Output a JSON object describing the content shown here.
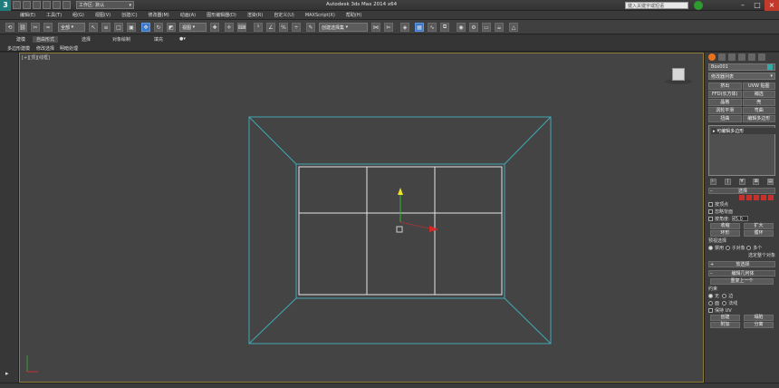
{
  "titlebar": {
    "logo": "3",
    "workspace": "工作区: 默认",
    "app_title": "Autodesk 3ds Max 2014 x64",
    "search_placeholder": "键入关键字或短语"
  },
  "menu": [
    "编辑(E)",
    "工具(T)",
    "组(G)",
    "视图(V)",
    "创建(C)",
    "修改器(M)",
    "动画(A)",
    "图形编辑器(D)",
    "渲染(R)",
    "自定义(U)",
    "MAXScript(X)",
    "帮助(H)"
  ],
  "toolbar": {
    "filter": "全部",
    "view": "视图",
    "named_sel": "创建选择集"
  },
  "ribbon": {
    "tabs": [
      "建模",
      "自由形式",
      "选择",
      "对象绘制",
      "填充"
    ],
    "subtabs": [
      "多边形建模",
      "修改选择",
      "明暗处理"
    ]
  },
  "viewport": {
    "label": "[+][顶][线框]"
  },
  "command_panel": {
    "object_name": "Box001",
    "modifier_list": "修改器列表",
    "buttons": [
      "挤出",
      "UVW 贴图",
      "FFD(长方体)",
      "補选",
      "晶格",
      "壳",
      "涡轮平滑",
      "弯曲",
      "扭曲",
      "编辑多边形"
    ],
    "stack_item": "▸ 可编辑多边形",
    "stack_tools": [
      "⊢",
      "|",
      "∀",
      "⊠",
      "▤"
    ],
    "selection": {
      "header": "选择",
      "by_vertex": "按顶点",
      "ignore_backface": "忽略背面",
      "by_angle": "按角度:",
      "angle_value": "45.0",
      "shrink": "收缩",
      "grow": "扩大",
      "ring": "环形",
      "loop": "循环",
      "preview_label": "预视选择",
      "preview_options": [
        "禁用",
        "子对象",
        "多个"
      ],
      "whole_object": "选定整个对象"
    },
    "soft_selection": {
      "header": "软选择"
    },
    "edit_geometry": {
      "header": "编辑几何体",
      "repeat": "重复上一个",
      "constraints_label": "约束",
      "constraints": [
        "无",
        "边",
        "面",
        "法线"
      ],
      "preserve_uv": "保持 UV",
      "create": "创建",
      "collapse": "塌陷",
      "attach": "附加",
      "detach": "分离"
    }
  }
}
